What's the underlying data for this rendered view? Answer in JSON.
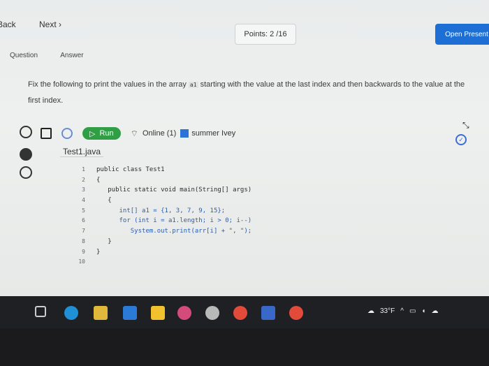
{
  "nav": {
    "back_label": "Back",
    "next_label": "Next"
  },
  "points": {
    "label": "Points: 2 /16"
  },
  "banner": {
    "open_label": "Open Present"
  },
  "tabs": [
    {
      "label": "Question"
    },
    {
      "label": "Answer"
    }
  ],
  "question": {
    "before": "Fix the following to print the values in the array ",
    "code": "a1",
    "after": " starting with the value at the last index and then backwards to the value at the first index."
  },
  "toolbar": {
    "run_label": "Run",
    "online_label": "Online (1)",
    "user_label": "summer Ivey",
    "user_color": "#2a74d8"
  },
  "editor": {
    "file_name": "Test1.java",
    "line_numbers": [
      "1",
      "2",
      "3",
      "4",
      "5",
      "6",
      "7",
      "8",
      "9",
      "10"
    ],
    "lines": [
      "public class Test1",
      "{",
      "   public static void main(String[] args)",
      "   {",
      "      int[] a1 = {1, 3, 7, 9, 15};",
      "      for (int i = a1.length; i > 0; i--)",
      "         System.out.print(arr[i] + \", \");",
      "   }",
      "}",
      ""
    ]
  },
  "taskbar": {
    "weather_label": "33°F"
  },
  "colors": {
    "run_button": "#2f9e44",
    "open_button": "#1d6fd6",
    "taskbar": "#1e2024"
  }
}
